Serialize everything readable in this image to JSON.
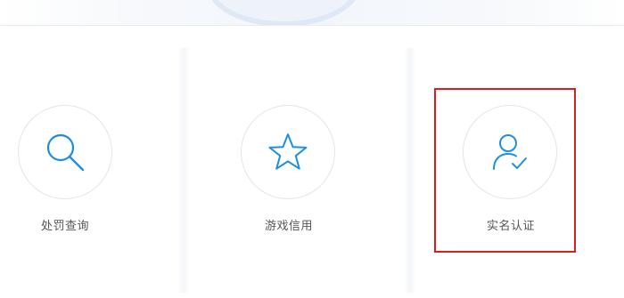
{
  "colors": {
    "icon": "#1e8fe0",
    "circle_border": "#dde6ef",
    "label": "#555555",
    "highlight": "#d62020"
  },
  "services": [
    {
      "label": "处罚查询",
      "icon": "search-icon"
    },
    {
      "label": "游戏信用",
      "icon": "star-icon"
    },
    {
      "label": "实名认证",
      "icon": "user-check-icon"
    }
  ]
}
